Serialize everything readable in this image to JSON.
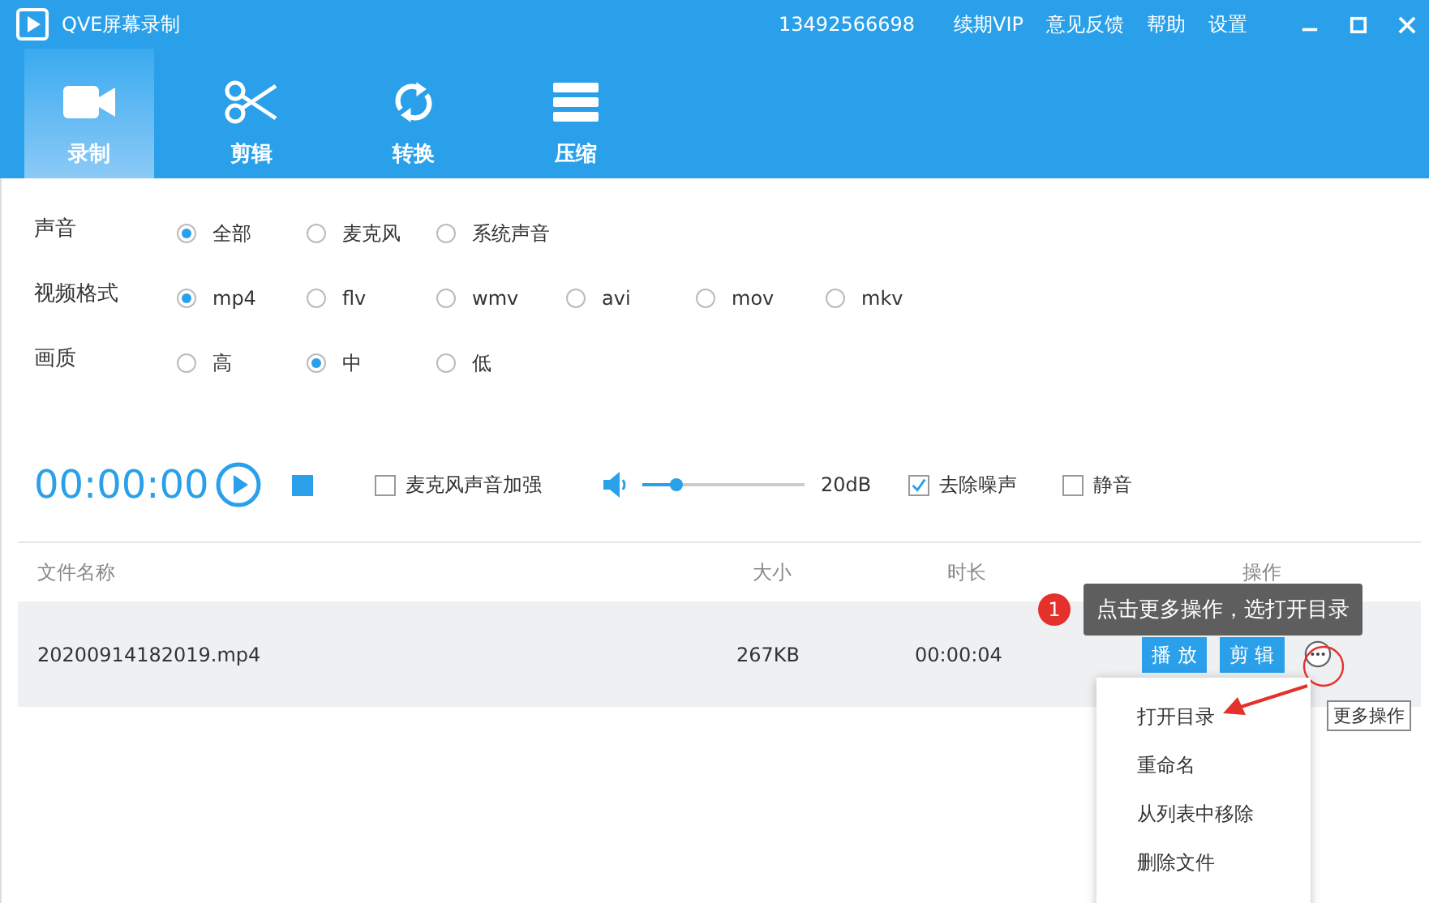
{
  "window": {
    "title": "QVE屏幕录制",
    "account": "13492566698",
    "menu": [
      "续期VIP",
      "意见反馈",
      "帮助",
      "设置"
    ]
  },
  "tabs": [
    {
      "label": "录制",
      "kind": "camera",
      "selected": true
    },
    {
      "label": "剪辑",
      "kind": "scissors",
      "selected": false
    },
    {
      "label": "转换",
      "kind": "convert",
      "selected": false
    },
    {
      "label": "压缩",
      "kind": "compress",
      "selected": false
    }
  ],
  "options": [
    {
      "label": "声音",
      "choices": [
        {
          "label": "全部",
          "selected": true
        },
        {
          "label": "麦克风",
          "selected": false
        },
        {
          "label": "系统声音",
          "selected": false
        }
      ]
    },
    {
      "label": "视频格式",
      "choices": [
        {
          "label": "mp4",
          "selected": true
        },
        {
          "label": "flv",
          "selected": false
        },
        {
          "label": "wmv",
          "selected": false
        },
        {
          "label": "avi",
          "selected": false
        },
        {
          "label": "mov",
          "selected": false
        },
        {
          "label": "mkv",
          "selected": false
        }
      ]
    },
    {
      "label": "画质",
      "choices": [
        {
          "label": "高",
          "selected": false
        },
        {
          "label": "中",
          "selected": true
        },
        {
          "label": "低",
          "selected": false
        }
      ]
    }
  ],
  "recorder": {
    "time": "00:00:00",
    "mic_boost": {
      "label": "麦克风声音加强",
      "checked": false
    },
    "volume": {
      "level": 0.21,
      "reading": "20dB"
    },
    "denoise": {
      "label": "去除噪声",
      "checked": true
    },
    "mute": {
      "label": "静音",
      "checked": false
    }
  },
  "table": {
    "columns": [
      "文件名称",
      "大小",
      "时长",
      "操作"
    ],
    "rows": [
      {
        "name": "20200914182019.mp4",
        "size": "267KB",
        "duration": "00:00:04",
        "actions": [
          "播 放",
          "剪 辑"
        ],
        "selected": true
      }
    ]
  },
  "context_menu": {
    "items": [
      "打开目录",
      "重命名",
      "从列表中移除",
      "删除文件"
    ]
  },
  "hint": {
    "badge": "1",
    "text": "点击更多操作，选打开目录"
  },
  "more_tooltip": "更多操作"
}
